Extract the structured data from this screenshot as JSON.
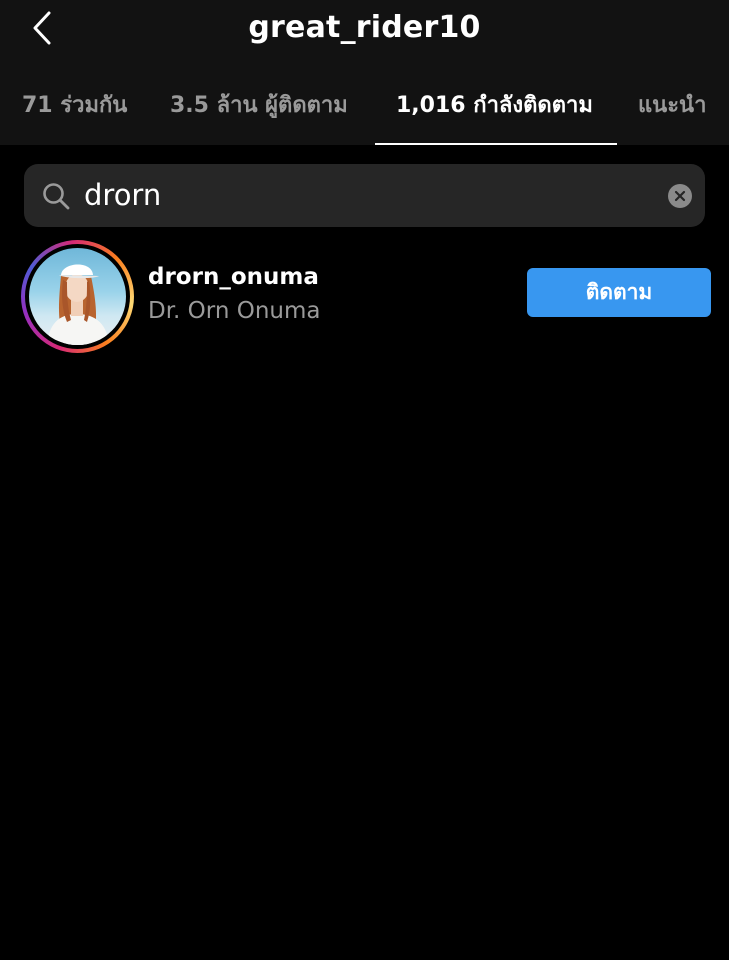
{
  "header": {
    "title": "great_rider10",
    "back_icon": "chevron-left-icon"
  },
  "tabs": [
    {
      "label": "71 ร่วมกัน",
      "active": false
    },
    {
      "label": "3.5 ล้าน ผู้ติดตาม",
      "active": false
    },
    {
      "label": "1,016 กำลังติดตาม",
      "active": true
    },
    {
      "label": "แนะนำ",
      "active": false
    }
  ],
  "search": {
    "value": "drorn",
    "placeholder": "",
    "search_icon": "search-icon",
    "clear_icon": "clear-icon"
  },
  "results": [
    {
      "username": "drorn_onuma",
      "fullname": "Dr. Orn Onuma",
      "follow_label": "ติดตาม"
    }
  ],
  "colors": {
    "accent": "#3897f0",
    "background": "#000000",
    "header_background": "#121212",
    "secondary_text": "#9a9a9a",
    "search_background": "#262626"
  }
}
